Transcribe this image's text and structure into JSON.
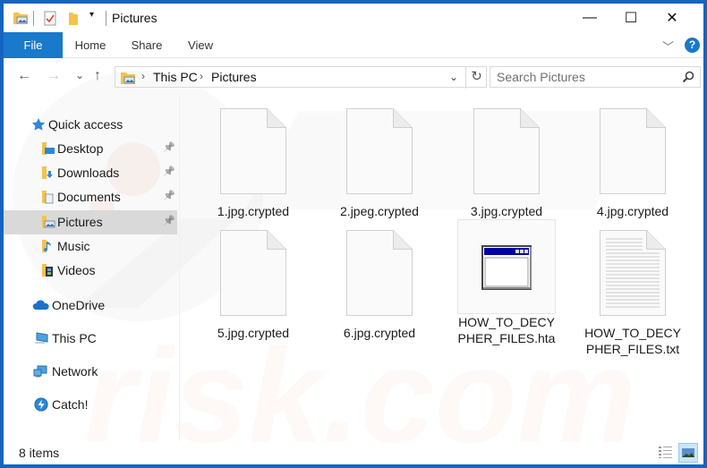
{
  "window": {
    "title": "Pictures",
    "controls": {
      "minimize": "—",
      "maximize": "☐",
      "close": "✕"
    }
  },
  "quick_access_toolbar": {
    "icons": [
      "pictures-folder-icon",
      "properties-check-icon",
      "new-folder-icon",
      "customize-dropdown-icon"
    ]
  },
  "ribbon": {
    "tabs": [
      {
        "label": "File",
        "active": true
      },
      {
        "label": "Home"
      },
      {
        "label": "Share"
      },
      {
        "label": "View"
      }
    ],
    "expand_icon": "﹀",
    "help_label": "?"
  },
  "navigation": {
    "back": "←",
    "forward": "→",
    "recent": "⌄",
    "up": "↑",
    "breadcrumb": [
      "This PC",
      "Pictures"
    ],
    "breadcrumb_sep": "›",
    "dropdown": "⌄",
    "refresh": "↻",
    "search_placeholder": "Search Pictures",
    "search_icon": "⚲"
  },
  "sidebar": {
    "items": [
      {
        "label": "Quick access",
        "icon": "star-icon"
      },
      {
        "label": "Desktop",
        "icon": "desktop-folder-icon",
        "pinned": true
      },
      {
        "label": "Downloads",
        "icon": "downloads-folder-icon",
        "pinned": true
      },
      {
        "label": "Documents",
        "icon": "documents-folder-icon",
        "pinned": true
      },
      {
        "label": "Pictures",
        "icon": "pictures-folder-icon",
        "pinned": true,
        "selected": true
      },
      {
        "label": "Music",
        "icon": "music-folder-icon"
      },
      {
        "label": "Videos",
        "icon": "videos-folder-icon"
      },
      {
        "label": "OneDrive",
        "icon": "onedrive-cloud-icon"
      },
      {
        "label": "This PC",
        "icon": "computer-icon"
      },
      {
        "label": "Network",
        "icon": "network-icon"
      },
      {
        "label": "Catch!",
        "icon": "catch-icon"
      }
    ],
    "pin_glyph": "📌"
  },
  "files": [
    {
      "name": "1.jpg.crypted",
      "type": "blank"
    },
    {
      "name": "2.jpeg.crypted",
      "type": "blank"
    },
    {
      "name": "3.jpg.crypted",
      "type": "blank"
    },
    {
      "name": "4.jpg.crypted",
      "type": "blank"
    },
    {
      "name": "5.jpg.crypted",
      "type": "blank"
    },
    {
      "name": "6.jpg.crypted",
      "type": "blank"
    },
    {
      "name": "HOW_TO_DECYPHER_FILES.hta",
      "type": "hta"
    },
    {
      "name": "HOW_TO_DECYPHER_FILES.txt",
      "type": "txt"
    }
  ],
  "status": {
    "item_count": "8 items"
  },
  "colors": {
    "accent": "#1979ca",
    "frame": "#1565c0",
    "selected": "#d9d9d9"
  }
}
